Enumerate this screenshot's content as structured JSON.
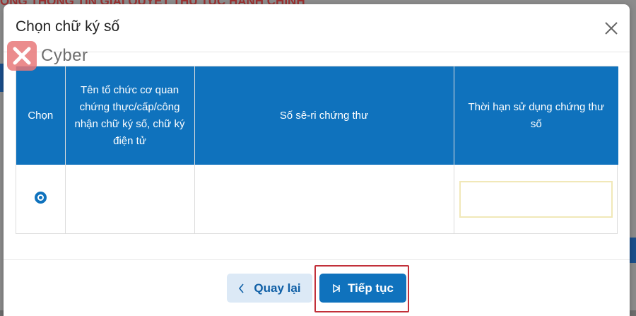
{
  "background": {
    "title_fragment": "ỐNG THÔNG TIN GIẢI QUYẾT THỦ TỤC HÀNH CHÍNH"
  },
  "logo": {
    "text": "Cyber",
    "icon": "x-logo-icon"
  },
  "modal": {
    "title": "Chọn chữ ký số",
    "close_icon": "close-icon"
  },
  "table": {
    "headers": [
      "Chọn",
      "Tên tổ chức cơ quan chứng thực/cấp/công nhận chữ ký số, chữ ký điện tử",
      "Số sê-ri chứng thư",
      "Thời hạn sử dụng chứng thư số"
    ],
    "rows": [
      {
        "selected": true,
        "organization": "",
        "serial": "",
        "expiry": ""
      }
    ]
  },
  "footer": {
    "back_label": "Quay lại",
    "back_icon": "chevron-left-icon",
    "next_label": "Tiếp tục",
    "next_icon": "play-outline-icon"
  },
  "colors": {
    "primary": "#0f72bd",
    "secondary_bg": "#dce9f6",
    "highlight": "#c2303a"
  }
}
